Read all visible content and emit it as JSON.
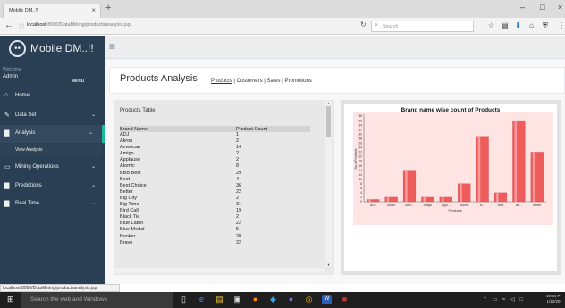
{
  "browser": {
    "tab_title": "Mobile DM..!!",
    "tab_close": "×",
    "new_tab": "+",
    "url_host": "localhost",
    "url_rest": ":8080/DataMining/productsanalysis.jsp",
    "search_placeholder": "Search",
    "window_min": "–",
    "window_max": "□",
    "window_close": "×",
    "status_url": "localhost:8080/DataMining/productsanalysis.jsp"
  },
  "sidebar": {
    "brand": "Mobile DM..!!",
    "welcome": "Welcome,",
    "user": "Admin",
    "menu_heading": "MENU",
    "items": [
      {
        "label": "Home",
        "icon": "home-icon"
      },
      {
        "label": "Data Set",
        "icon": "edit-icon"
      },
      {
        "label": "Analysis",
        "icon": "bar-chart-icon"
      },
      {
        "label": "Mining Operations",
        "icon": "desktop-icon"
      },
      {
        "label": "Predictions",
        "icon": "bar-chart-icon"
      },
      {
        "label": "Real Time",
        "icon": "bar-chart-icon"
      }
    ],
    "submenu_item": "View Analysis"
  },
  "page": {
    "title": "Products Analysis",
    "links": [
      "Products",
      "Customers",
      "Sales",
      "Promotions"
    ],
    "separator": "|"
  },
  "table": {
    "caption": "Products Table",
    "headers": [
      "Brand Name",
      "Product Count"
    ],
    "rows": [
      [
        "ADJ",
        "1"
      ],
      [
        "Akron",
        "2"
      ],
      [
        "American",
        "14"
      ],
      [
        "Amigo",
        "2"
      ],
      [
        "Applause",
        "2"
      ],
      [
        "Atomic",
        "8"
      ],
      [
        "BBB Best",
        "29"
      ],
      [
        "Best",
        "4"
      ],
      [
        "Best Choice",
        "36"
      ],
      [
        "Better",
        "22"
      ],
      [
        "Big City",
        "2"
      ],
      [
        "Big Time",
        "31"
      ],
      [
        "Bird Call",
        "19"
      ],
      [
        "Black Tie",
        "2"
      ],
      [
        "Blue Label",
        "22"
      ],
      [
        "Blue Medal",
        "5"
      ],
      [
        "Booker",
        "20"
      ],
      [
        "Bravo",
        "22"
      ]
    ]
  },
  "chart_data": {
    "type": "bar",
    "title": "Brand name wise count of Products",
    "xlabel": "Products",
    "ylabel": "No.ofProducts",
    "categories": [
      "ADJ",
      "Akron",
      "Ame...",
      "Amigo",
      "Appl...",
      "Atomic",
      "B...",
      "Best",
      "Be...",
      "Better"
    ],
    "values": [
      1,
      2,
      14,
      2,
      2,
      8,
      29,
      4,
      36,
      22
    ],
    "ylim": [
      0,
      38
    ],
    "yticks": [
      0,
      2,
      4,
      6,
      8,
      10,
      12,
      14,
      16,
      18,
      20,
      22,
      24,
      26,
      28,
      30,
      32,
      34,
      36,
      38
    ],
    "bar_color": "#ee5c5c",
    "background": "#ffe4e4",
    "grid": false,
    "legend": "none"
  },
  "taskbar": {
    "search_placeholder": "Search the web and Windows",
    "clock_time": "10:34 P",
    "clock_date": "1/12/20"
  }
}
